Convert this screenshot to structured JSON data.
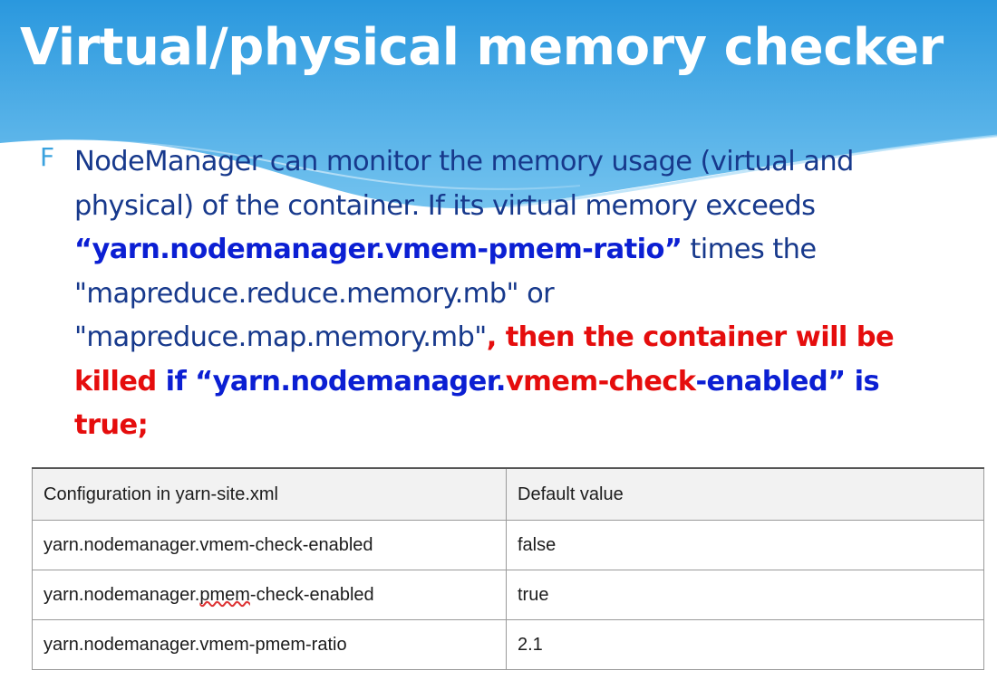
{
  "slide": {
    "title": "Virtual/physical memory checker",
    "bullet_icon": "F",
    "bullet": {
      "t1": "NodeManager can monitor the memory usage (virtual and physical) of the container. If its virtual memory exceeds ",
      "t2": "“yarn.nodemanager.vmem-pmem-ratio”",
      "t3": " times the \"mapreduce.reduce.memory.mb\" or \"mapreduce.map.memory.mb\"",
      "t4": ",",
      "t5": " then the container will be killed",
      "t6": " if “yarn.nodemanager.",
      "t7": "vmem-check",
      "t8": "-enabled” is",
      "t9": " true;"
    }
  },
  "table": {
    "headers": [
      "Configuration in yarn-site.xml",
      "Default value"
    ],
    "rows": [
      [
        "yarn.nodemanager.vmem-check-enabled",
        "false"
      ],
      {
        "c1_pre": "yarn.nodemanager.",
        "c1_mark": "pmem",
        "c1_post": "-check-enabled",
        "c2": "true"
      },
      [
        "yarn.nodemanager.vmem-pmem-ratio",
        "2.1"
      ]
    ]
  },
  "colors": {
    "banner_top": "#2e9ce0",
    "banner_bottom": "#72c1ee",
    "body_text": "#17398c",
    "highlight_blue": "#0b1fd3",
    "highlight_red": "#e50d0d"
  }
}
